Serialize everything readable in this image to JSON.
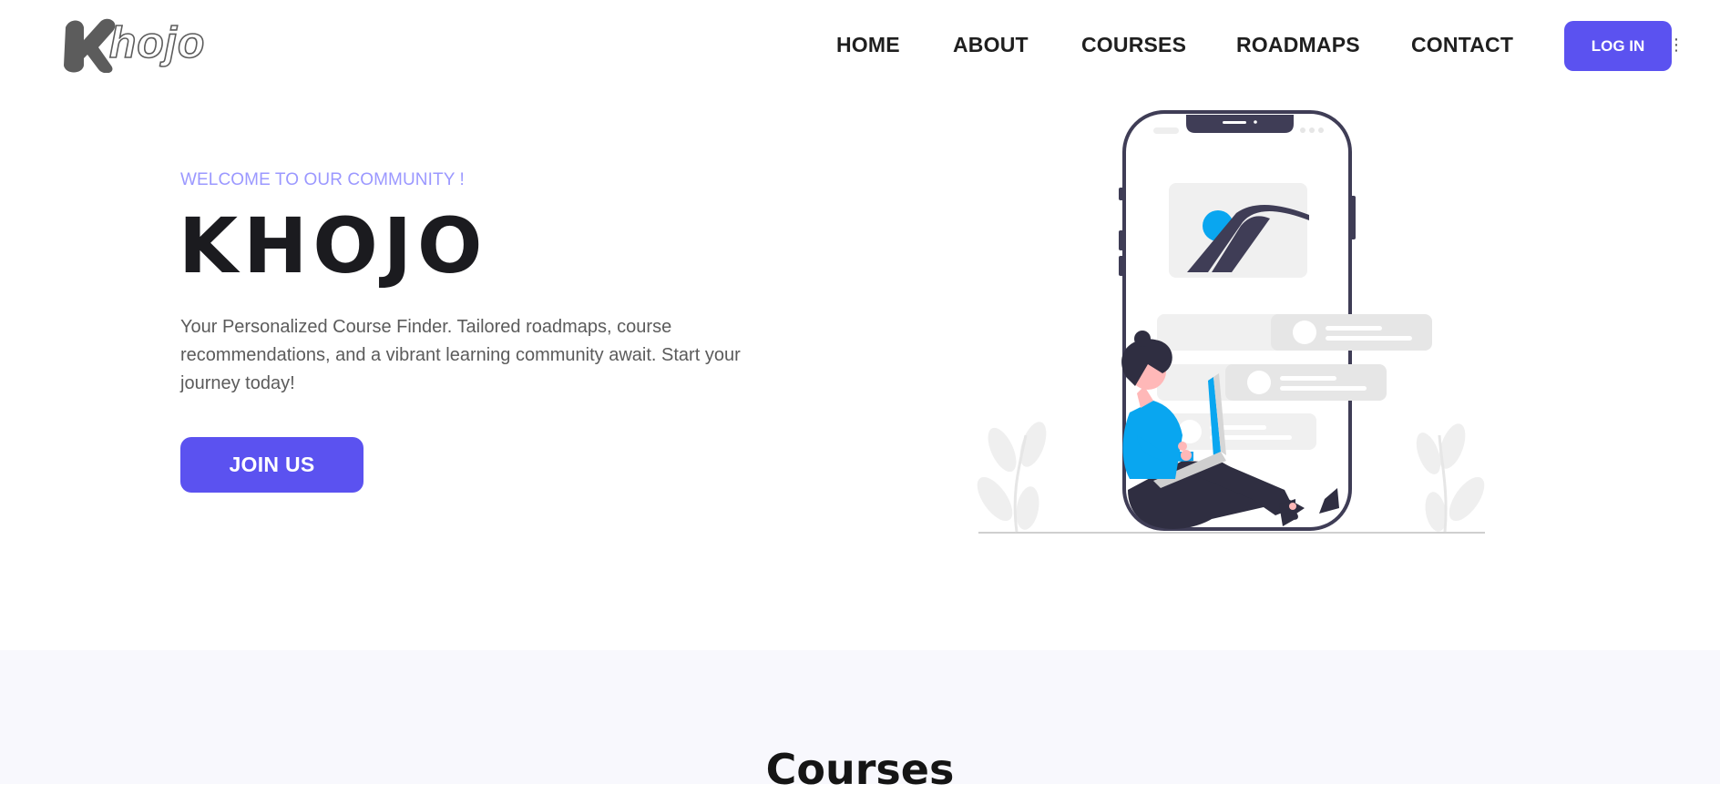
{
  "brand": {
    "logo_text": "Khojo",
    "logo_word": "hojo",
    "accent_color": "#5b52f0"
  },
  "nav": {
    "items": [
      {
        "label": "HOME"
      },
      {
        "label": "ABOUT"
      },
      {
        "label": "COURSES"
      },
      {
        "label": "ROADMAPS"
      },
      {
        "label": "CONTACT"
      }
    ],
    "login_label": "LOG IN",
    "overflow_icon": "kebab-icon"
  },
  "hero": {
    "eyebrow": "WELCOME TO OUR COMMUNITY !",
    "title": "KHOJO",
    "description": "Your Personalized Course Finder. Tailored roadmaps, course recommendations, and a vibrant learning community await. Start your journey today!",
    "cta_label": "JOIN US",
    "illustration": "person-with-laptop-and-phone-illustration"
  },
  "courses": {
    "heading": "Courses"
  }
}
